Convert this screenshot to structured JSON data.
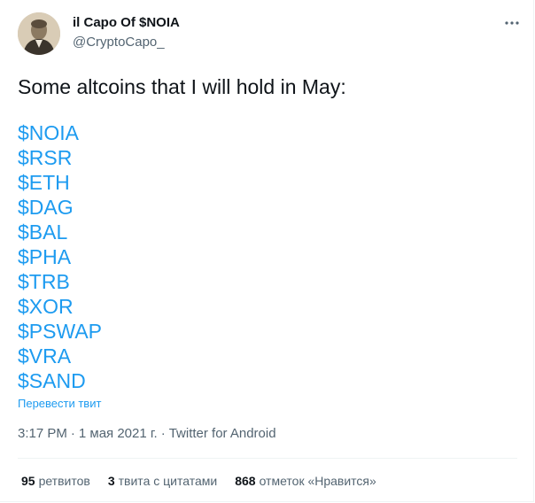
{
  "author": {
    "name": "il Capo Of $NOIA",
    "handle": "@CryptoCapo_"
  },
  "tweet": {
    "text": "Some altcoins that I will hold in May:",
    "cashtags": [
      "$NOIA",
      "$RSR",
      "$ETH",
      "$DAG",
      "$BAL",
      "$PHA",
      "$TRB",
      "$XOR",
      "$PSWAP",
      "$VRA",
      "$SAND"
    ],
    "translate_label": "Перевести твит"
  },
  "meta": {
    "time": "3:17 PM",
    "separator": "·",
    "date": "1 мая 2021 г.",
    "source": "Twitter for Android"
  },
  "stats": {
    "retweets": {
      "count": "95",
      "label": "ретвитов"
    },
    "quotes": {
      "count": "3",
      "label": "твита с цитатами"
    },
    "likes": {
      "count": "868",
      "label": "отметок «Нравится»"
    }
  },
  "icons": {
    "more": "more-horizontal-icon",
    "avatar": "avatar-image"
  },
  "colors": {
    "link": "#1d9bf0",
    "text": "#0f1419",
    "secondary": "#536471",
    "border": "#eff3f4"
  }
}
